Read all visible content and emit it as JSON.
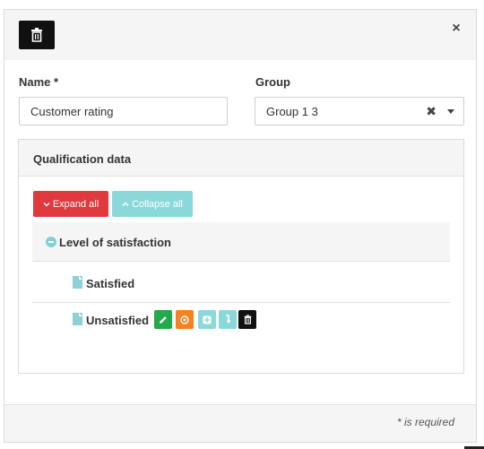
{
  "modal": {
    "close_symbol": "×",
    "header": {
      "delete_icon": "trash-icon"
    }
  },
  "form": {
    "name_label": "Name *",
    "name_value": "Customer rating",
    "group_label": "Group",
    "group_value": "Group 1 3",
    "group_clear_symbol": "✖"
  },
  "panel": {
    "title": "Qualification data",
    "expand_label": "Expand all",
    "collapse_label": "Collapse all"
  },
  "tree": {
    "root": {
      "label": "Level of satisfaction",
      "icon": "minus-circle-icon"
    },
    "items": [
      {
        "label": "Satisfied",
        "icon": "file-icon"
      },
      {
        "label": "Unsatisfied",
        "icon": "file-icon"
      }
    ],
    "actions": [
      "pencil-icon",
      "target-icon",
      "plus-icon",
      "move-icon",
      "trash-icon"
    ]
  },
  "footer": {
    "required_note": "* is required"
  },
  "colors": {
    "danger": "#e0393e",
    "info": "#8bd8db",
    "success": "#21a94a",
    "warning": "#f58220",
    "dark": "#111111"
  }
}
